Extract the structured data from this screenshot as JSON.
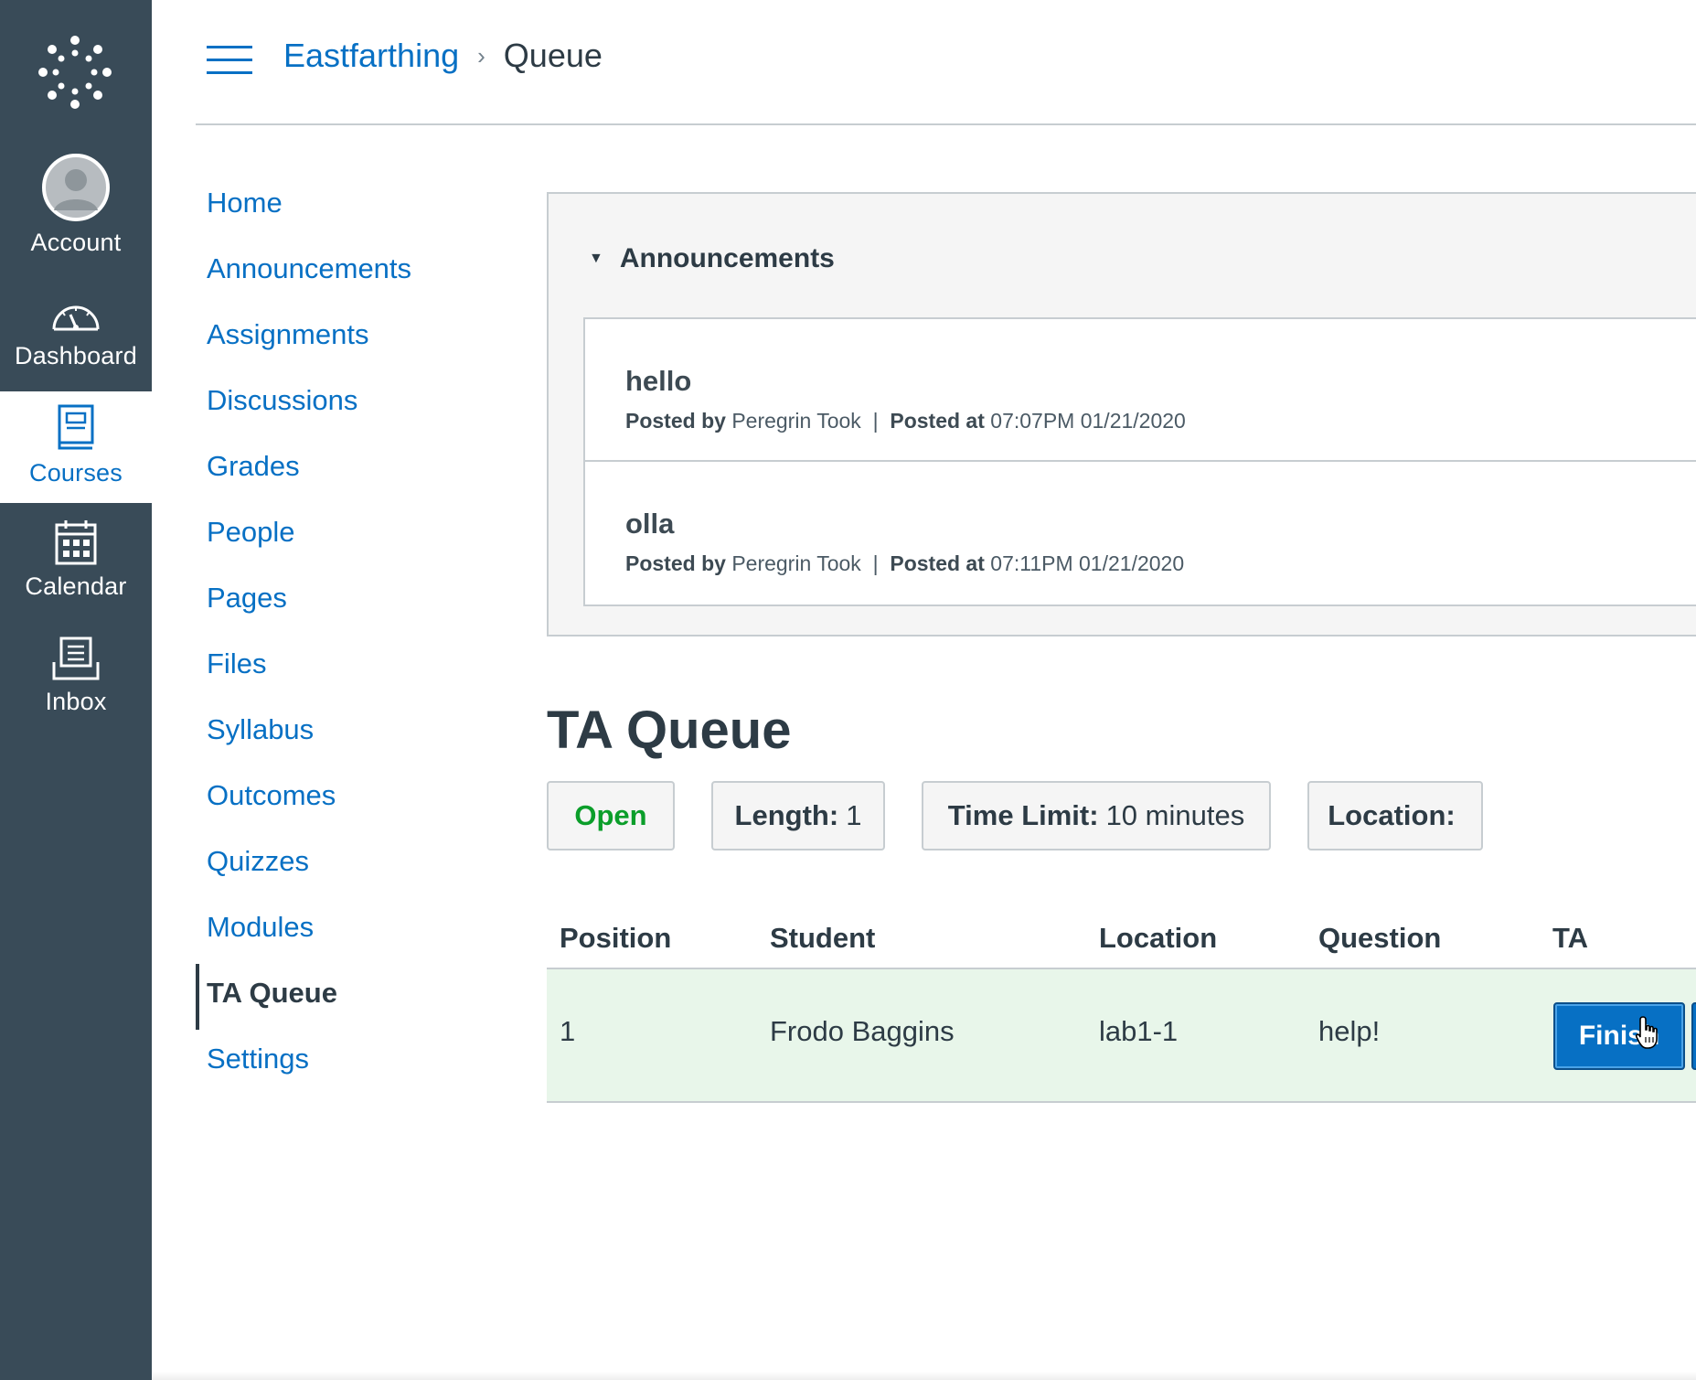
{
  "global_nav": {
    "items": [
      {
        "id": "account",
        "label": "Account",
        "icon": "avatar-icon"
      },
      {
        "id": "dashboard",
        "label": "Dashboard",
        "icon": "speedometer-icon"
      },
      {
        "id": "courses",
        "label": "Courses",
        "icon": "book-icon",
        "active": true
      },
      {
        "id": "calendar",
        "label": "Calendar",
        "icon": "calendar-icon"
      },
      {
        "id": "inbox",
        "label": "Inbox",
        "icon": "inbox-icon"
      }
    ]
  },
  "breadcrumb": {
    "course": "Eastfarthing",
    "current": "Queue"
  },
  "course_nav": {
    "items": [
      "Home",
      "Announcements",
      "Assignments",
      "Discussions",
      "Grades",
      "People",
      "Pages",
      "Files",
      "Syllabus",
      "Outcomes",
      "Quizzes",
      "Modules",
      "TA Queue",
      "Settings"
    ],
    "active": "TA Queue"
  },
  "announcements": {
    "heading": "Announcements",
    "posted_by_label": "Posted by",
    "posted_at_label": "Posted at",
    "separator": "|",
    "items": [
      {
        "title": "hello",
        "author": "Peregrin Took",
        "time": "07:07PM 01/21/2020"
      },
      {
        "title": "olla",
        "author": "Peregrin Took",
        "time": "07:11PM 01/21/2020"
      }
    ]
  },
  "queue": {
    "title": "TA Queue",
    "status": "Open",
    "length_label": "Length:",
    "length_value": "1",
    "time_limit_label": "Time Limit:",
    "time_limit_value": "10 minutes",
    "location_label": "Location:",
    "location_value": "",
    "columns": [
      "Position",
      "Student",
      "Location",
      "Question",
      "TA"
    ],
    "rows": [
      {
        "position": "1",
        "student": "Frodo Baggins",
        "location": "lab1-1",
        "question": "help!",
        "action_label": "Finish"
      }
    ]
  },
  "colors": {
    "nav_bg": "#394b58",
    "link": "#0770c4",
    "open_status": "#0b9e2a",
    "row_highlight": "#e8f6ea"
  }
}
